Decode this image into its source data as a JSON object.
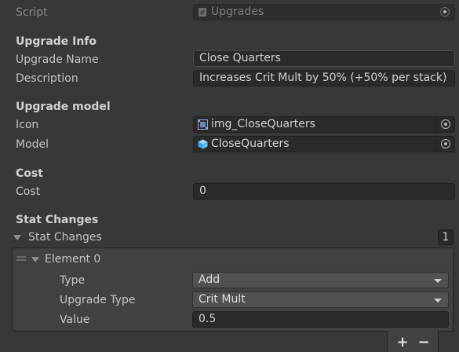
{
  "script": {
    "label": "Script",
    "value": "Upgrades"
  },
  "upgrade_info": {
    "header": "Upgrade Info",
    "name_label": "Upgrade Name",
    "name_value": "Close Quarters",
    "description_label": "Description",
    "description_value": "Increases Crit Mult by 50% (+50% per stack)"
  },
  "upgrade_model": {
    "header": "Upgrade model",
    "icon_label": "Icon",
    "icon_value": "img_CloseQuarters",
    "model_label": "Model",
    "model_value": "CloseQuarters"
  },
  "cost": {
    "header": "Cost",
    "label": "Cost",
    "value": "0"
  },
  "stat_changes": {
    "header": "Stat Changes",
    "list_label": "Stat Changes",
    "size": "1",
    "elements": [
      {
        "label": "Element 0",
        "type_label": "Type",
        "type_value": "Add",
        "upgrade_type_label": "Upgrade Type",
        "upgrade_type_value": "Crit Mult",
        "value_label": "Value",
        "value_value": "0.5"
      }
    ],
    "add_button": "+",
    "remove_button": "−"
  },
  "colors": {
    "background": "#383838",
    "field": "#2a2a2a",
    "dropdown": "#515151",
    "list_box": "#414141"
  }
}
